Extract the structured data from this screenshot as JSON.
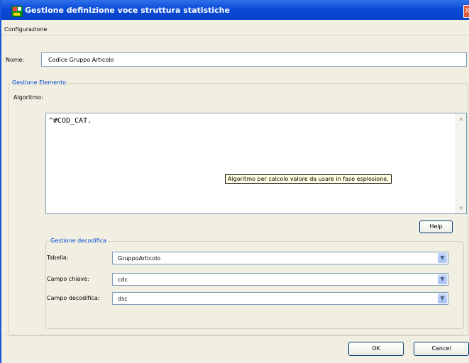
{
  "window": {
    "title": "Gestione definizione voce struttura statistiche",
    "close_glyph": "X"
  },
  "menu": {
    "items": [
      "Configurazione"
    ]
  },
  "name_field": {
    "label": "Nome:",
    "value": "Codice Gruppo Articolo"
  },
  "element_group": {
    "legend": "Gestione Elemento",
    "algorithm_label": "Algoritmo:",
    "algorithm_value": "^#COD_CAT.",
    "tooltip": "Algoritmo per calcolo valore da usare in fase esplosione."
  },
  "help_button": {
    "label": "Help"
  },
  "decode_group": {
    "legend": "Gestione decodifica",
    "fields": [
      {
        "label": "Tabella:",
        "value": "GruppoArticolo"
      },
      {
        "label": "Campo chiave:",
        "value": "cdc"
      },
      {
        "label": "Campo decodifica:",
        "value": "dsc"
      }
    ]
  },
  "footer": {
    "ok_label": "OK",
    "cancel_label": "Cancel"
  },
  "icons": {
    "app": "app-icon",
    "close": "close-icon",
    "dropdown": "chevron-down-icon"
  }
}
